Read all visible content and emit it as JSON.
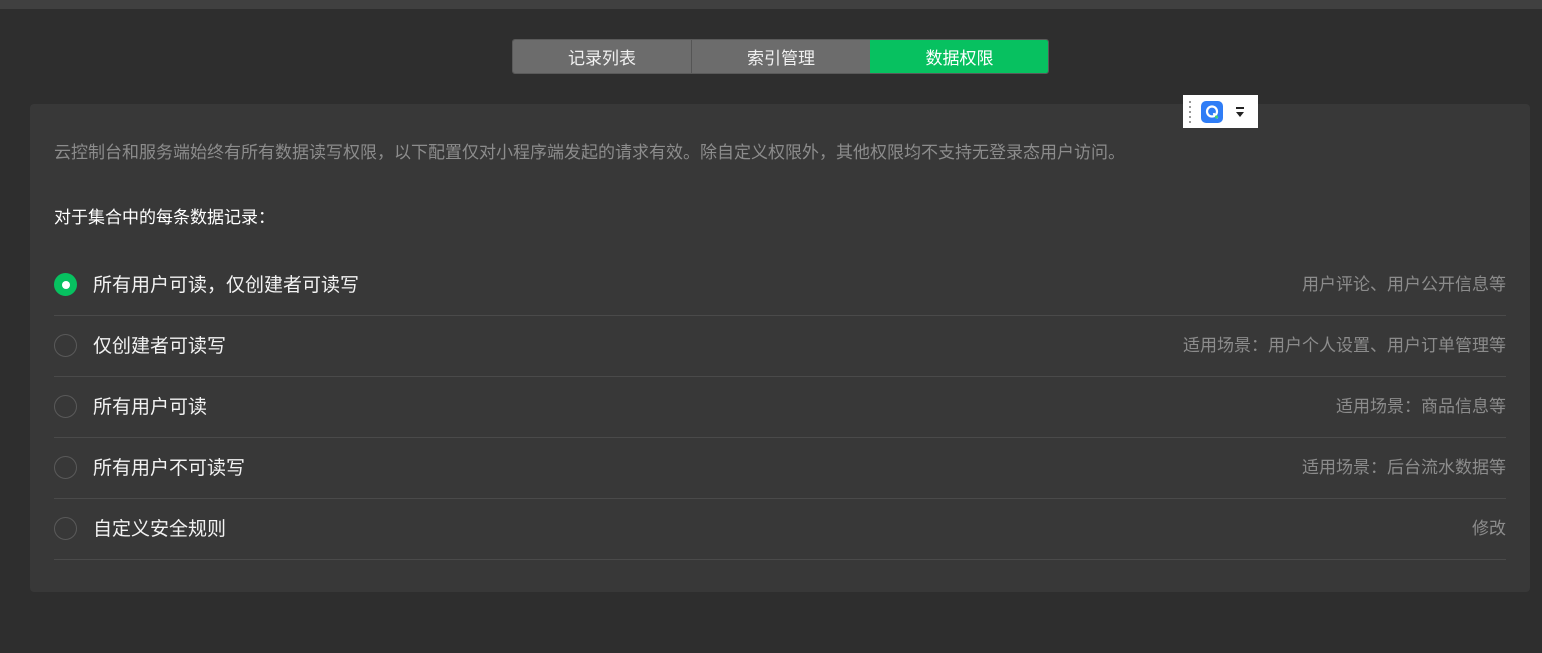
{
  "tabs": [
    {
      "label": "记录列表",
      "active": false
    },
    {
      "label": "索引管理",
      "active": false
    },
    {
      "label": "数据权限",
      "active": true
    }
  ],
  "notice": "云控制台和服务端始终有所有数据读写权限，以下配置仅对小程序端发起的请求有效。除自定义权限外，其他权限均不支持无登录态用户访问。",
  "section_title": "对于集合中的每条数据记录：",
  "options": [
    {
      "label": "所有用户可读，仅创建者可读写",
      "hint": "用户评论、用户公开信息等",
      "selected": true
    },
    {
      "label": "仅创建者可读写",
      "hint": "适用场景：用户个人设置、用户订单管理等",
      "selected": false
    },
    {
      "label": "所有用户可读",
      "hint": "适用场景：商品信息等",
      "selected": false
    },
    {
      "label": "所有用户不可读写",
      "hint": "适用场景：后台流水数据等",
      "selected": false
    },
    {
      "label": "自定义安全规则",
      "hint": "修改",
      "selected": false
    }
  ],
  "colors": {
    "accent": "#07c160",
    "background": "#2e2e2e",
    "panel": "#383838",
    "tab_inactive": "#6c6c6c",
    "muted_text": "#8c8c8c"
  },
  "icons": {
    "overlay_app": "q-app-icon",
    "overlay_arrows": "dropdown-arrow-icon",
    "overlay_grip": "drag-handle-icon"
  }
}
